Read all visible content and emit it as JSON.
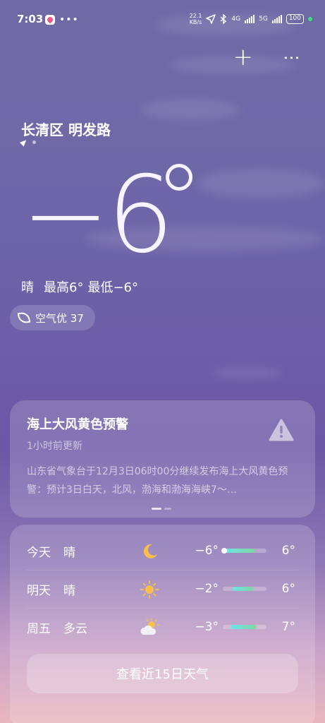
{
  "status": {
    "time": "7:03",
    "dots": "•••",
    "speed_value": "22.1",
    "speed_unit": "KB/s",
    "net1": "4G",
    "net2": "5G",
    "battery": "100"
  },
  "location": {
    "name": "长清区 明发路"
  },
  "current": {
    "temperature": "−6",
    "condition": "晴",
    "high": "最高6°",
    "low": "最低−6°",
    "aqi": "空气优 37"
  },
  "alert": {
    "title": "海上大风黄色预警",
    "updated": "1小时前更新",
    "body": "山东省气象台于12月3日06时00分继续发布海上大风黄色预警：预计3日白天，北风，渤海和渤海海峡7～…"
  },
  "forecast": [
    {
      "day": "今天",
      "condition": "晴",
      "icon": "moon-icon",
      "low": "−6°",
      "high": "6°",
      "fill_start": 0.0,
      "fill_end": 0.72,
      "dot": true
    },
    {
      "day": "明天",
      "condition": "晴",
      "icon": "sun-icon",
      "low": "−2°",
      "high": "6°",
      "fill_start": 0.22,
      "fill_end": 0.7,
      "dot": false
    },
    {
      "day": "周五",
      "condition": "多云",
      "icon": "cloud-sun-icon",
      "low": "−3°",
      "high": "7°",
      "fill_start": 0.18,
      "fill_end": 0.78,
      "dot": false
    }
  ],
  "forecast_button": "查看近15日天气",
  "colors": {
    "bar_gradient_start": "#6fe3e6",
    "bar_gradient_end": "#7fd7a6",
    "warning_icon": "#c9c3de",
    "moon": "#f6c04a"
  }
}
